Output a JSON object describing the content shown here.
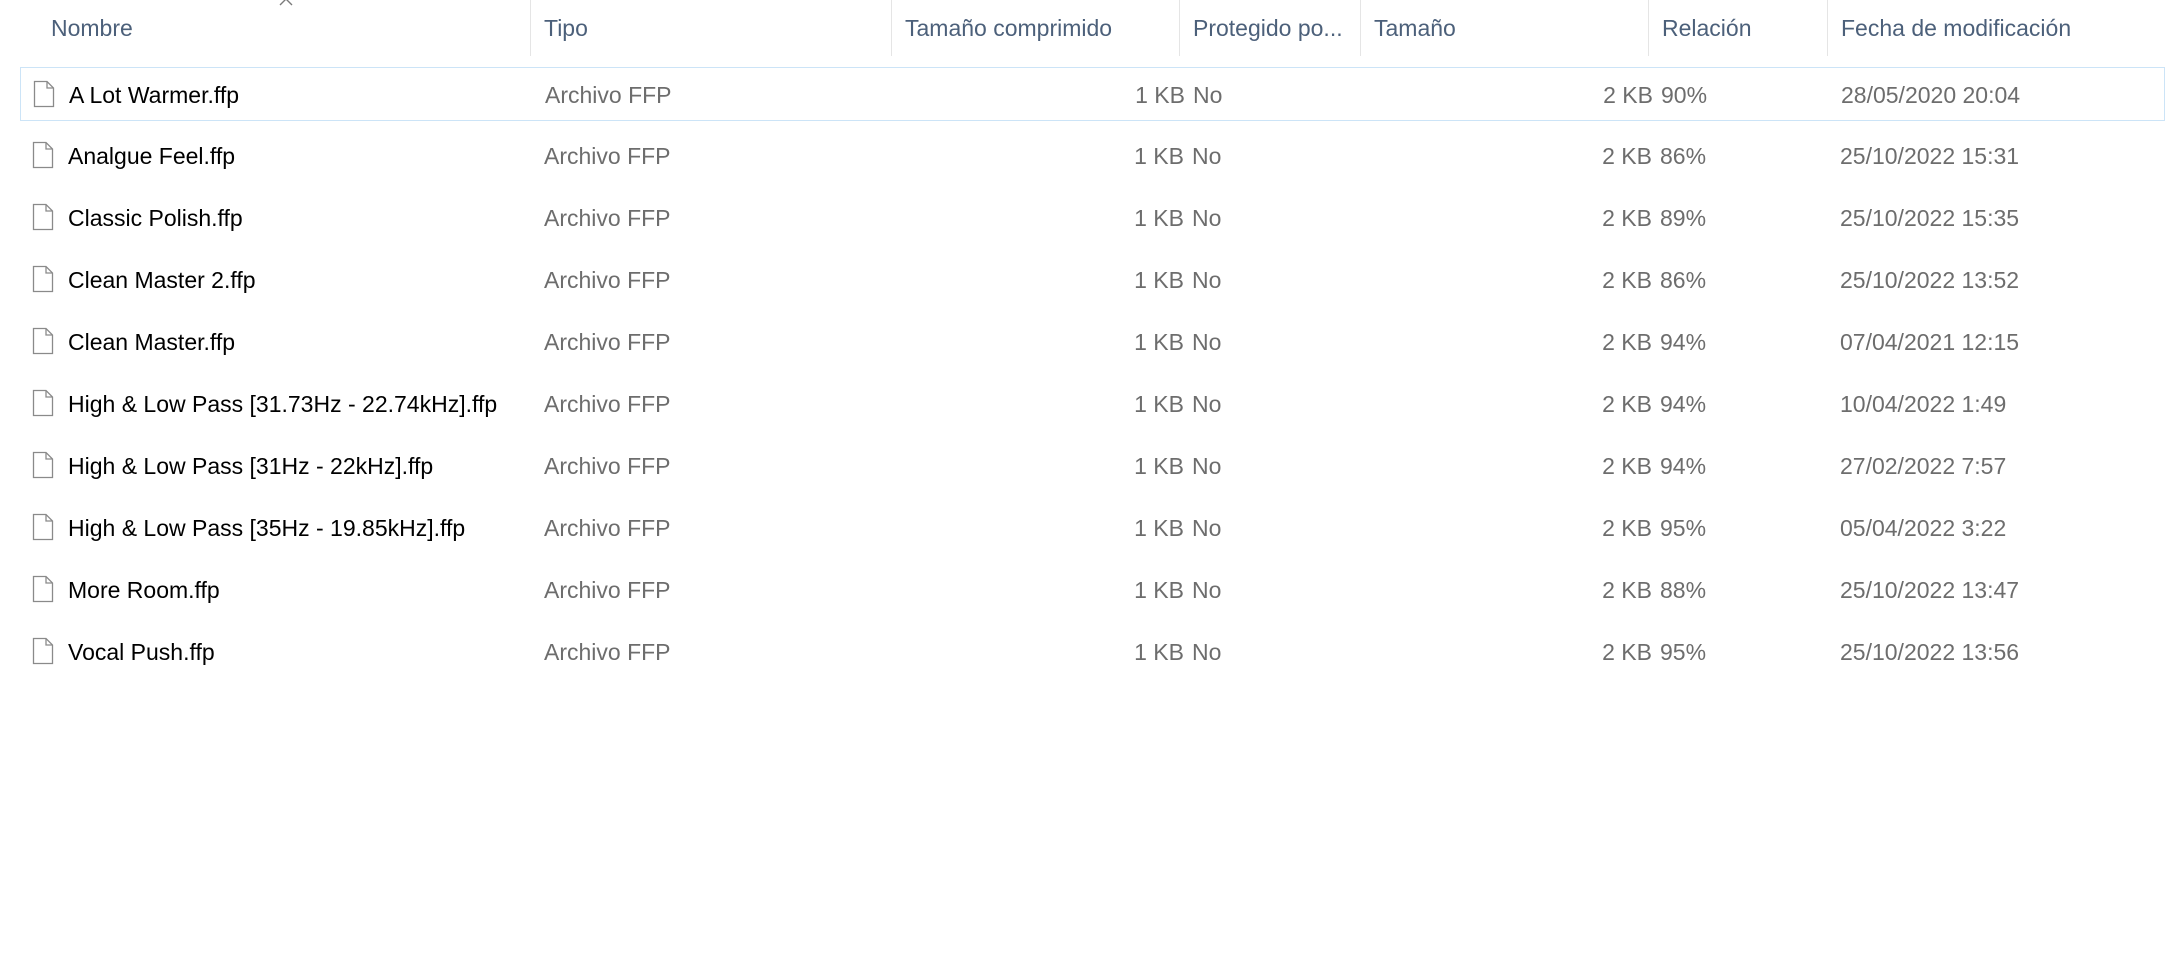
{
  "columns": {
    "name": "Nombre",
    "type": "Tipo",
    "compressed": "Tamaño comprimido",
    "protected": "Protegido po...",
    "size": "Tamaño",
    "ratio": "Relación",
    "modified": "Fecha de modificación"
  },
  "sort": {
    "column": "name",
    "direction": "ascending",
    "icon": "chevron-up-icon"
  },
  "selected_row": 0,
  "files": [
    {
      "name": "A Lot Warmer.ffp",
      "type": "Archivo FFP",
      "compressed": "1 KB",
      "protected": "No",
      "size": "2 KB",
      "ratio": "90%",
      "modified": "28/05/2020 20:04"
    },
    {
      "name": "Analgue Feel.ffp",
      "type": "Archivo FFP",
      "compressed": "1 KB",
      "protected": "No",
      "size": "2 KB",
      "ratio": "86%",
      "modified": "25/10/2022 15:31"
    },
    {
      "name": "Classic Polish.ffp",
      "type": "Archivo FFP",
      "compressed": "1 KB",
      "protected": "No",
      "size": "2 KB",
      "ratio": "89%",
      "modified": "25/10/2022 15:35"
    },
    {
      "name": "Clean Master 2.ffp",
      "type": "Archivo FFP",
      "compressed": "1 KB",
      "protected": "No",
      "size": "2 KB",
      "ratio": "86%",
      "modified": "25/10/2022 13:52"
    },
    {
      "name": "Clean Master.ffp",
      "type": "Archivo FFP",
      "compressed": "1 KB",
      "protected": "No",
      "size": "2 KB",
      "ratio": "94%",
      "modified": "07/04/2021 12:15"
    },
    {
      "name": "High & Low Pass [31.73Hz - 22.74kHz].ffp",
      "type": "Archivo FFP",
      "compressed": "1 KB",
      "protected": "No",
      "size": "2 KB",
      "ratio": "94%",
      "modified": "10/04/2022 1:49"
    },
    {
      "name": "High & Low Pass [31Hz - 22kHz].ffp",
      "type": "Archivo FFP",
      "compressed": "1 KB",
      "protected": "No",
      "size": "2 KB",
      "ratio": "94%",
      "modified": "27/02/2022 7:57"
    },
    {
      "name": "High & Low Pass [35Hz - 19.85kHz].ffp",
      "type": "Archivo FFP",
      "compressed": "1 KB",
      "protected": "No",
      "size": "2 KB",
      "ratio": "95%",
      "modified": "05/04/2022 3:22"
    },
    {
      "name": "More Room.ffp",
      "type": "Archivo FFP",
      "compressed": "1 KB",
      "protected": "No",
      "size": "2 KB",
      "ratio": "88%",
      "modified": "25/10/2022 13:47"
    },
    {
      "name": "Vocal Push.ffp",
      "type": "Archivo FFP",
      "compressed": "1 KB",
      "protected": "No",
      "size": "2 KB",
      "ratio": "95%",
      "modified": "25/10/2022 13:56"
    }
  ],
  "colors": {
    "header_text": "#4c607a",
    "muted_text": "#6d6d6d",
    "selection_border": "#cce4f7"
  },
  "row_icon": "file-icon"
}
